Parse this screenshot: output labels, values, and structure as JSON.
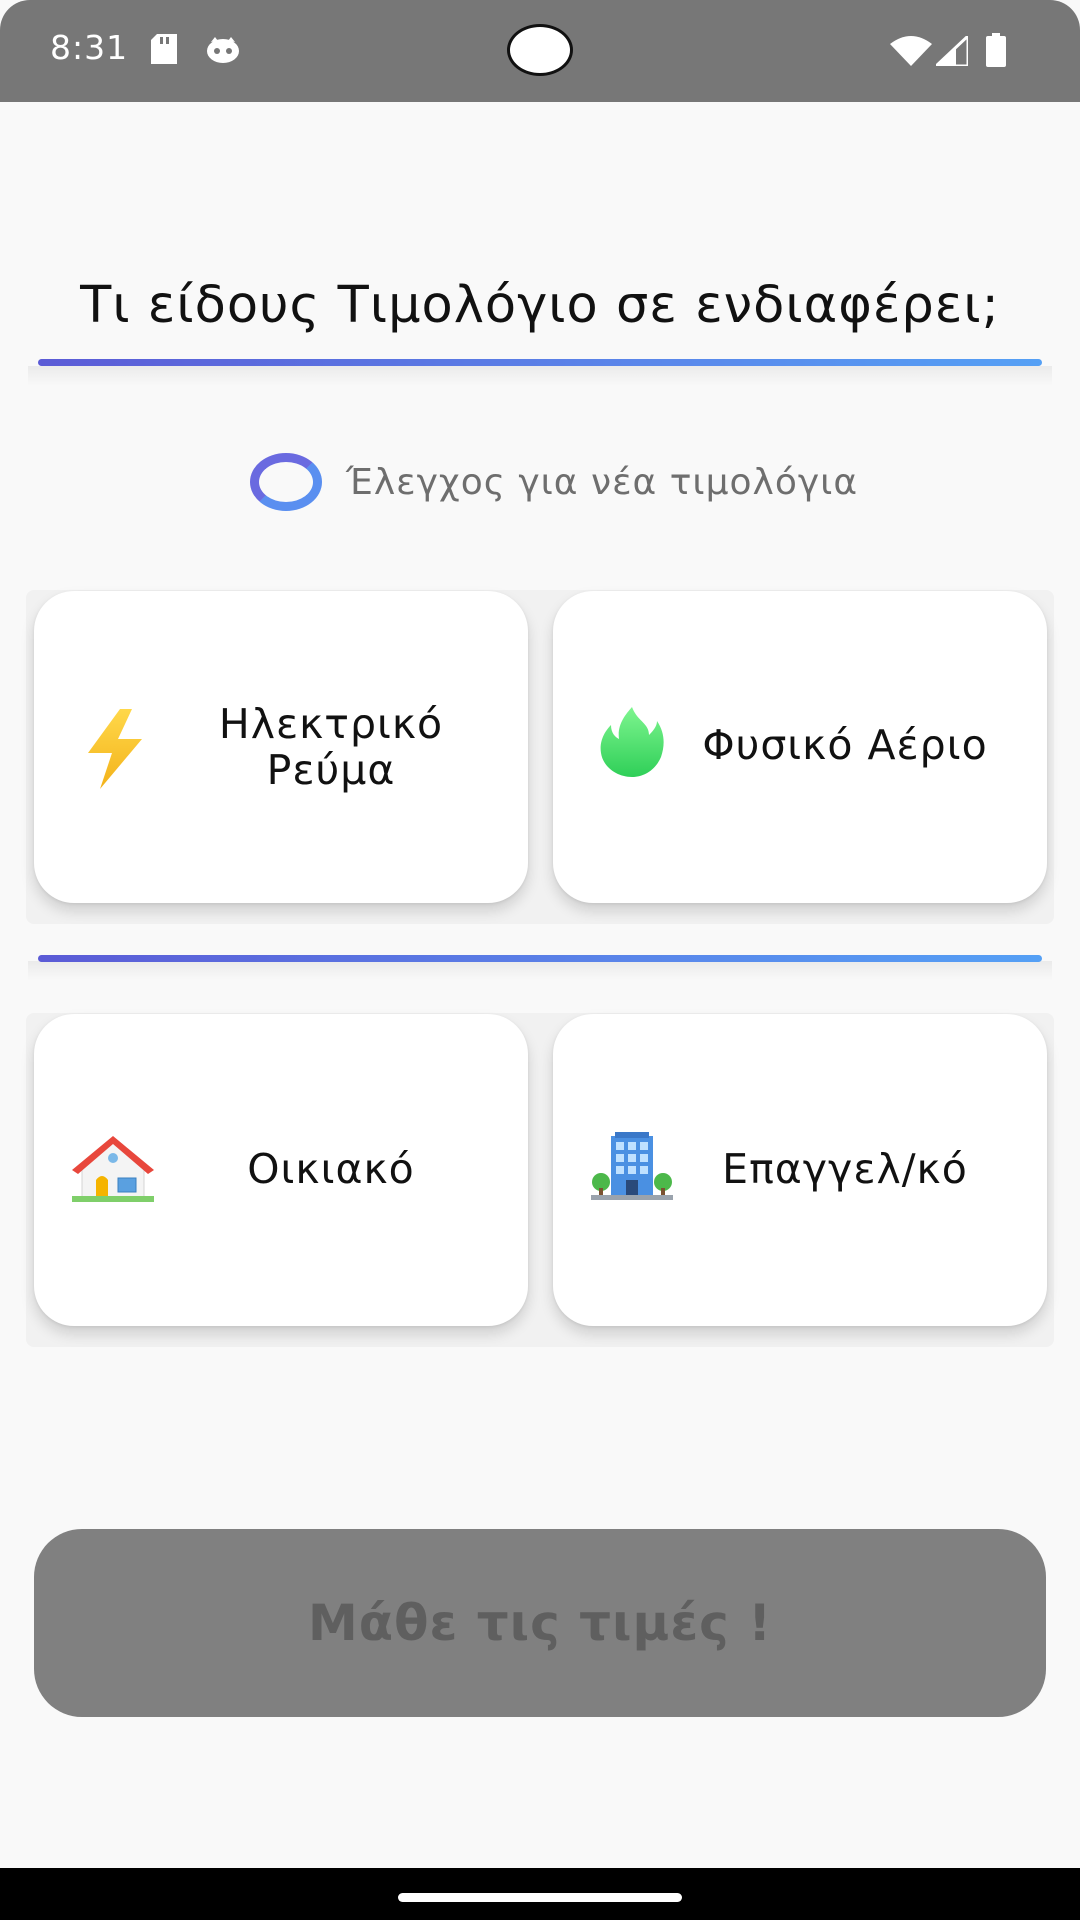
{
  "status_bar": {
    "time": "8:31",
    "icons": [
      "sd-card-icon",
      "notification-face-icon",
      "wifi-icon",
      "signal-icon",
      "battery-icon"
    ]
  },
  "main": {
    "title": "Τι είδους Τιμολόγιο σε ενδιαφέρει;",
    "check_toggle": {
      "label": "Έλεγχος για νέα τιμολόγια",
      "checked": false
    },
    "energy_cards": [
      {
        "label": "Ηλεκτρικό Ρεύμα",
        "icon": "lightning-icon"
      },
      {
        "label": "Φυσικό Αέριο",
        "icon": "flame-icon"
      }
    ],
    "type_cards": [
      {
        "label": "Οικιακό",
        "icon": "house-icon"
      },
      {
        "label": "Επαγγελ/κό",
        "icon": "office-building-icon"
      }
    ],
    "action_button": {
      "label": "Μάθε τις τιμές !",
      "enabled": false
    }
  },
  "colors": {
    "accent_start": "#5b5bd6",
    "accent_end": "#55a0f5",
    "button_disabled": "#808080"
  }
}
